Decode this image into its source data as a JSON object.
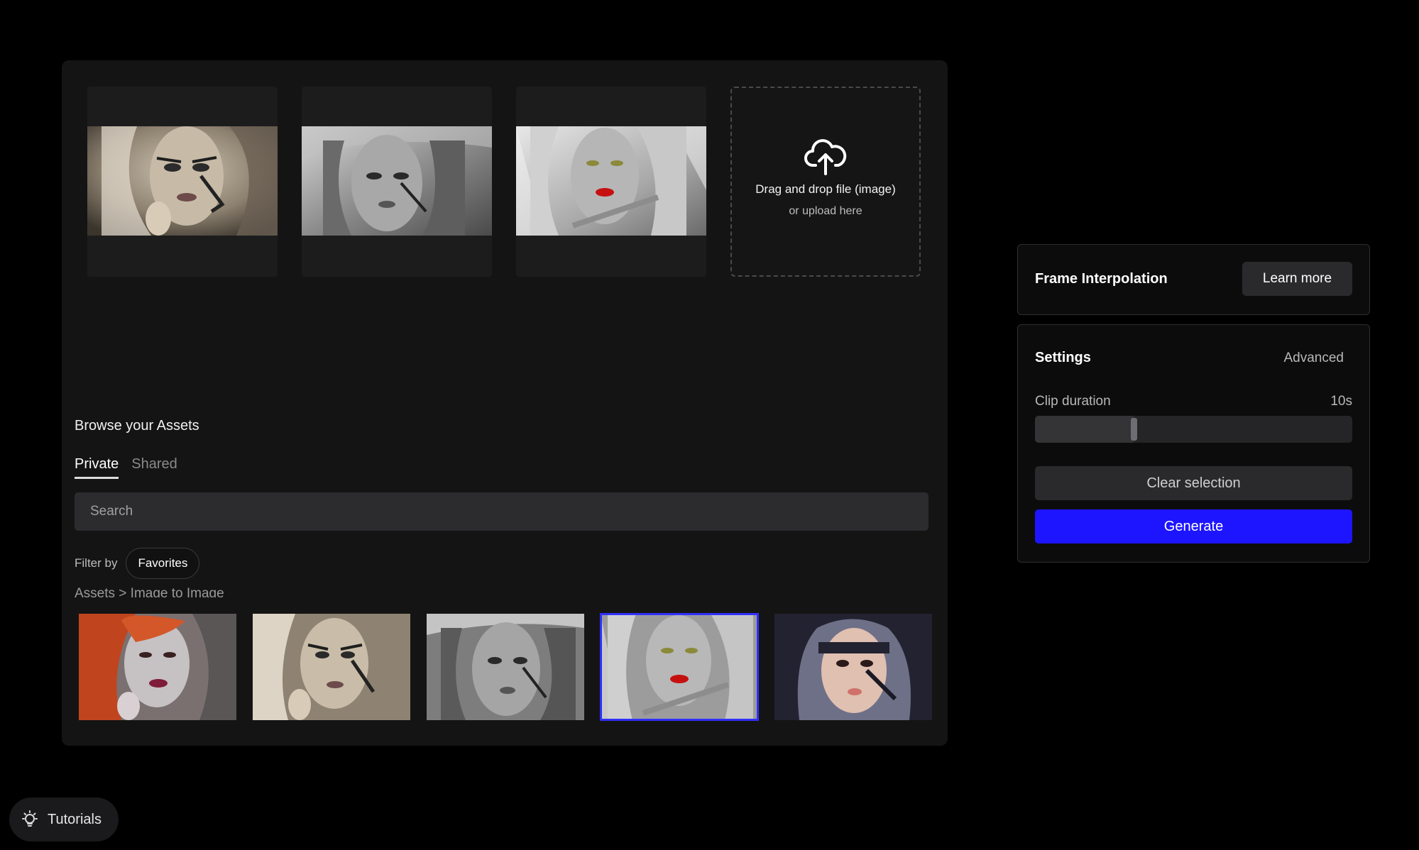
{
  "upload": {
    "title": "Drag and drop file (image)",
    "subtitle": "or upload here",
    "icon": "cloud-upload-icon"
  },
  "frames": [
    {
      "label": "frame-1",
      "tone": "sepia"
    },
    {
      "label": "frame-2",
      "tone": "grey"
    },
    {
      "label": "frame-3",
      "tone": "silver-red"
    }
  ],
  "browse": {
    "title": "Browse your Assets",
    "tabs": [
      {
        "label": "Private",
        "active": true
      },
      {
        "label": "Shared",
        "active": false
      }
    ],
    "search_placeholder": "Search",
    "filter_label": "Filter by",
    "filter_chip": "Favorites",
    "breadcrumb": "Assets > Image to Image"
  },
  "assets": [
    {
      "tone": "red-hair",
      "selected": false
    },
    {
      "tone": "sepia",
      "selected": false
    },
    {
      "tone": "grey",
      "selected": false
    },
    {
      "tone": "silver-red",
      "selected": true
    },
    {
      "tone": "color-dark-hair",
      "selected": false
    }
  ],
  "frame_interpolation": {
    "title": "Frame Interpolation",
    "learn_more": "Learn more"
  },
  "settings": {
    "title": "Settings",
    "advanced": "Advanced",
    "clip_duration_label": "Clip duration",
    "clip_duration_value": "10s",
    "clip_duration_fraction": 0.31,
    "clear_selection": "Clear selection",
    "generate": "Generate"
  },
  "colors": {
    "accent": "#1d15ff",
    "panel": "#141414",
    "background": "#000000"
  },
  "tutorials": {
    "label": "Tutorials",
    "icon": "lightbulb-icon"
  }
}
